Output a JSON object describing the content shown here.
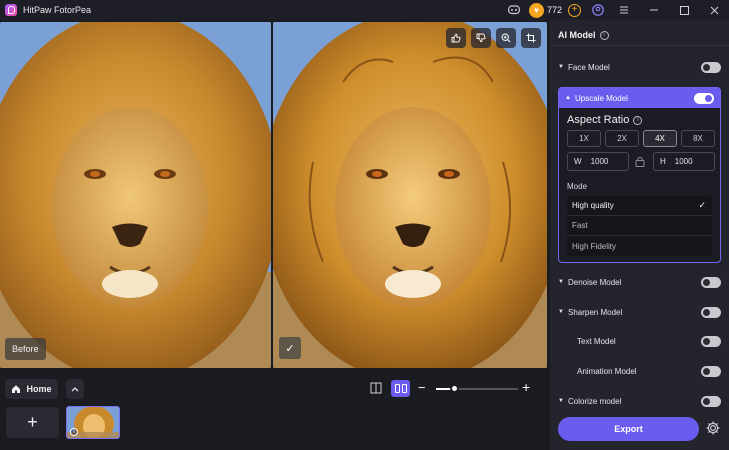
{
  "titlebar": {
    "app_title": "HitPaw FotorPea",
    "coin_count": "772",
    "icons": [
      "discord-icon",
      "coin-icon",
      "add-credits-icon",
      "account-icon",
      "menu-icon",
      "minimize-icon",
      "maximize-icon",
      "close-icon"
    ]
  },
  "preview": {
    "before_label": "Before",
    "tools": [
      "thumbs-up-icon",
      "thumbs-down-icon",
      "zoom-icon",
      "crop-icon"
    ]
  },
  "bottom": {
    "home_label": "Home",
    "zoom_percent": 22
  },
  "side": {
    "title": "AI Model",
    "models": [
      {
        "label": "Face Model",
        "on": false
      },
      {
        "label": "Upscale Model",
        "on": true
      },
      {
        "label": "Denoise Model",
        "on": false
      },
      {
        "label": "Sharpen Model",
        "on": false
      },
      {
        "label": "Text Model",
        "on": false
      },
      {
        "label": "Animation Model",
        "on": false
      },
      {
        "label": "Colorize model",
        "on": false
      }
    ],
    "upscale": {
      "aspect_title": "Aspect Ratio",
      "scales": [
        "1X",
        "2X",
        "4X",
        "8X"
      ],
      "selected_scale": "4X",
      "width_label": "W",
      "width_value": "1000",
      "height_label": "H",
      "height_value": "1000",
      "mode_label": "Mode",
      "modes": [
        "High quality",
        "Fast",
        "High Fidelity"
      ],
      "selected_mode": "High quality"
    },
    "export_label": "Export"
  },
  "colors": {
    "accent": "#6b5cf0",
    "background": "#1b1b22",
    "panel": "#24242d",
    "coin": "#f5a623"
  }
}
